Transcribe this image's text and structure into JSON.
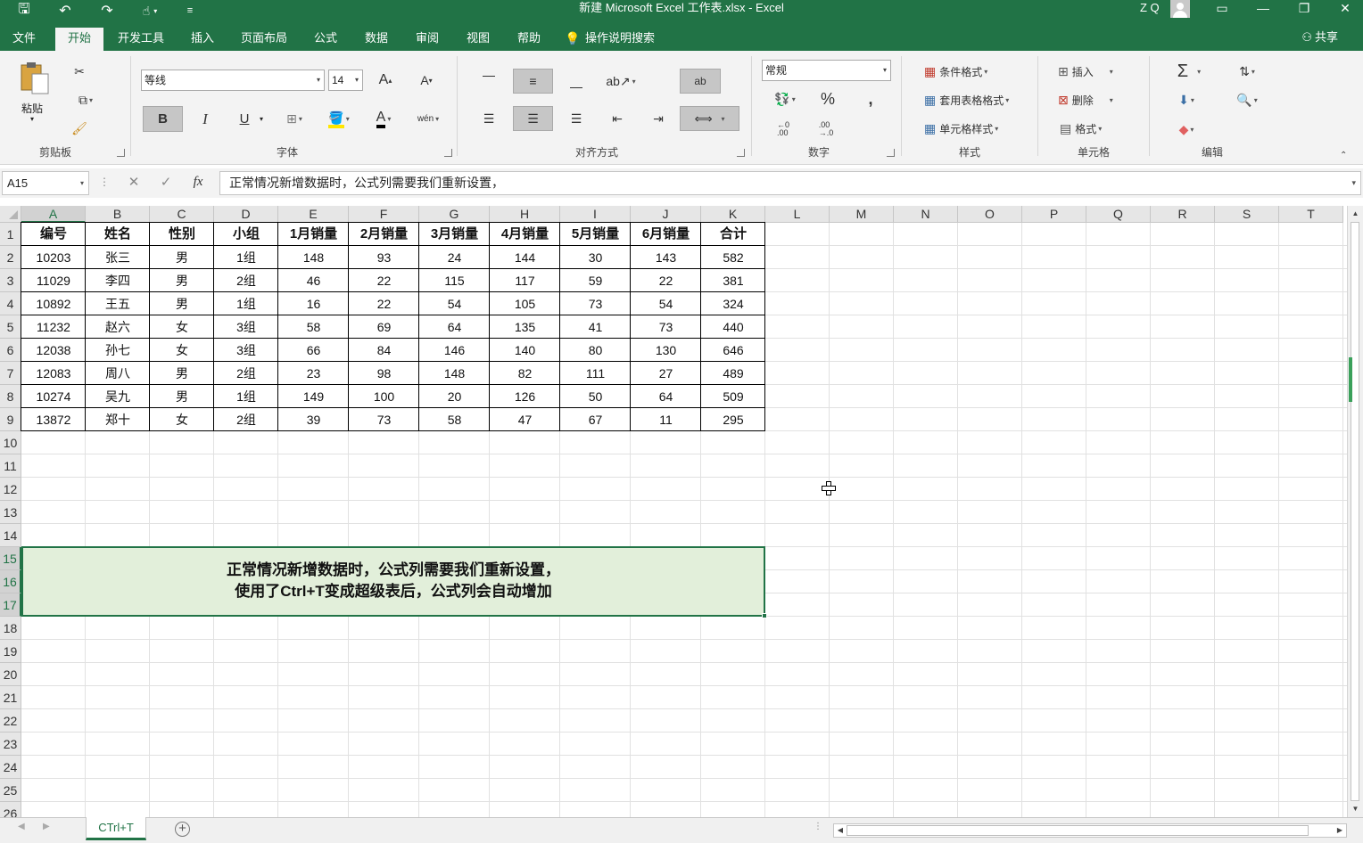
{
  "window": {
    "title": "新建 Microsoft Excel 工作表.xlsx  -  Excel",
    "user": "Z Q"
  },
  "tabs": [
    "文件",
    "开始",
    "开发工具",
    "插入",
    "页面布局",
    "公式",
    "数据",
    "审阅",
    "视图",
    "帮助",
    "操作说明搜索"
  ],
  "share_label": "共享",
  "ribbon": {
    "clipboard": {
      "label": "剪贴板",
      "paste": "粘贴"
    },
    "font": {
      "label": "字体",
      "name": "等线",
      "size": "14",
      "bold": "B",
      "italic": "I",
      "underline": "U",
      "color": "A",
      "wen": "wén"
    },
    "alignment": {
      "label": "对齐方式",
      "wrap": "ab"
    },
    "number": {
      "label": "数字",
      "format": "常规",
      "percent": "%",
      "comma": ","
    },
    "styles": {
      "label": "样式",
      "conditional": "条件格式",
      "table": "套用表格格式",
      "cell": "单元格样式"
    },
    "cells": {
      "label": "单元格",
      "insert": "插入",
      "delete": "删除",
      "format": "格式"
    },
    "editing": {
      "label": "编辑",
      "sum": "Σ"
    }
  },
  "formula_bar": {
    "name_box": "A15",
    "fx": "fx",
    "content": "正常情况新增数据时，公式列需要我们重新设置，"
  },
  "columns": [
    "A",
    "B",
    "C",
    "D",
    "E",
    "F",
    "G",
    "H",
    "I",
    "J",
    "K",
    "L",
    "M",
    "N",
    "O",
    "P",
    "Q",
    "R",
    "S",
    "T"
  ],
  "rows": [
    "1",
    "2",
    "3",
    "4",
    "5",
    "6",
    "7",
    "8",
    "9",
    "10",
    "11",
    "12",
    "13",
    "14",
    "15",
    "16",
    "17",
    "18",
    "19",
    "20",
    "21",
    "22",
    "23",
    "24",
    "25",
    "26"
  ],
  "table": {
    "headers": [
      "编号",
      "姓名",
      "性别",
      "小组",
      "1月销量",
      "2月销量",
      "3月销量",
      "4月销量",
      "5月销量",
      "6月销量",
      "合计"
    ],
    "data": [
      [
        "10203",
        "张三",
        "男",
        "1组",
        "148",
        "93",
        "24",
        "144",
        "30",
        "143",
        "582"
      ],
      [
        "11029",
        "李四",
        "男",
        "2组",
        "46",
        "22",
        "115",
        "117",
        "59",
        "22",
        "381"
      ],
      [
        "10892",
        "王五",
        "男",
        "1组",
        "16",
        "22",
        "54",
        "105",
        "73",
        "54",
        "324"
      ],
      [
        "11232",
        "赵六",
        "女",
        "3组",
        "58",
        "69",
        "64",
        "135",
        "41",
        "73",
        "440"
      ],
      [
        "12038",
        "孙七",
        "女",
        "3组",
        "66",
        "84",
        "146",
        "140",
        "80",
        "130",
        "646"
      ],
      [
        "12083",
        "周八",
        "男",
        "2组",
        "23",
        "98",
        "148",
        "82",
        "111",
        "27",
        "489"
      ],
      [
        "10274",
        "吴九",
        "男",
        "1组",
        "149",
        "100",
        "20",
        "126",
        "50",
        "64",
        "509"
      ],
      [
        "13872",
        "郑十",
        "女",
        "2组",
        "39",
        "73",
        "58",
        "47",
        "67",
        "11",
        "295"
      ]
    ]
  },
  "note": {
    "line1": "正常情况新增数据时，公式列需要我们重新设置，",
    "line2": "使用了Ctrl+T变成超级表后，公式列会自动增加"
  },
  "sheet_tab": "CTrl+T"
}
